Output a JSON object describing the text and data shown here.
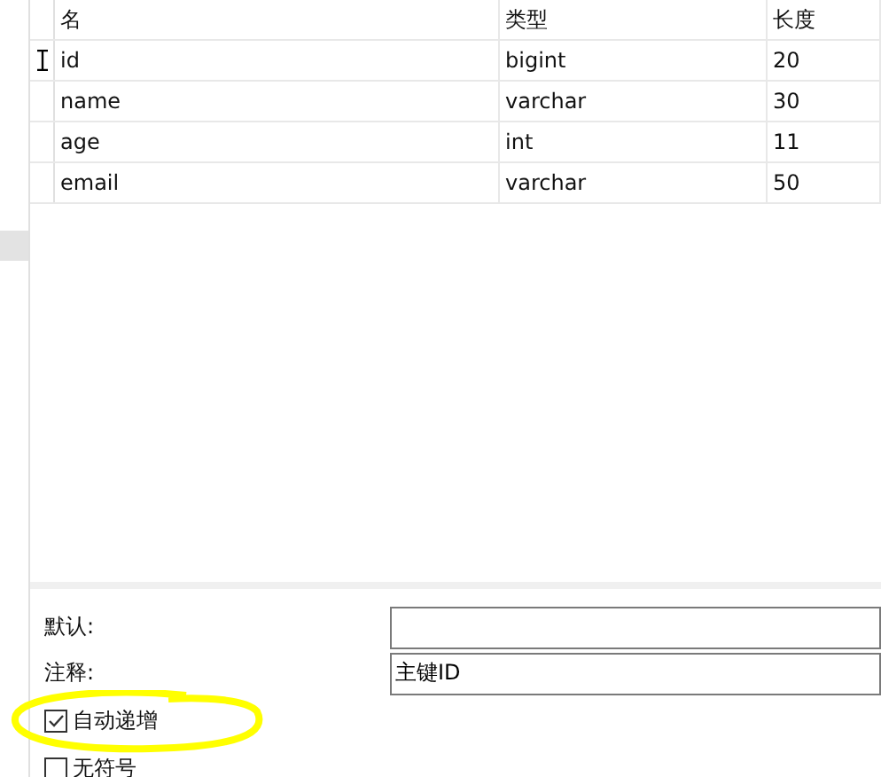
{
  "table": {
    "columns": [
      "名",
      "类型",
      "长度"
    ],
    "rows": [
      {
        "cells": [
          "id",
          "bigint",
          "20"
        ],
        "selected": true
      },
      {
        "cells": [
          "name",
          "varchar",
          "30"
        ],
        "selected": false
      },
      {
        "cells": [
          "age",
          "int",
          "11"
        ],
        "selected": false
      },
      {
        "cells": [
          "email",
          "varchar",
          "50"
        ],
        "selected": false
      }
    ]
  },
  "form": {
    "fields": [
      {
        "label": "默认:"
      },
      {
        "label": "注释:",
        "value": "主键ID"
      }
    ],
    "checkboxes": [
      {
        "label": "自动递增",
        "checked": true
      },
      {
        "label": "无符号",
        "checked": false
      }
    ]
  }
}
